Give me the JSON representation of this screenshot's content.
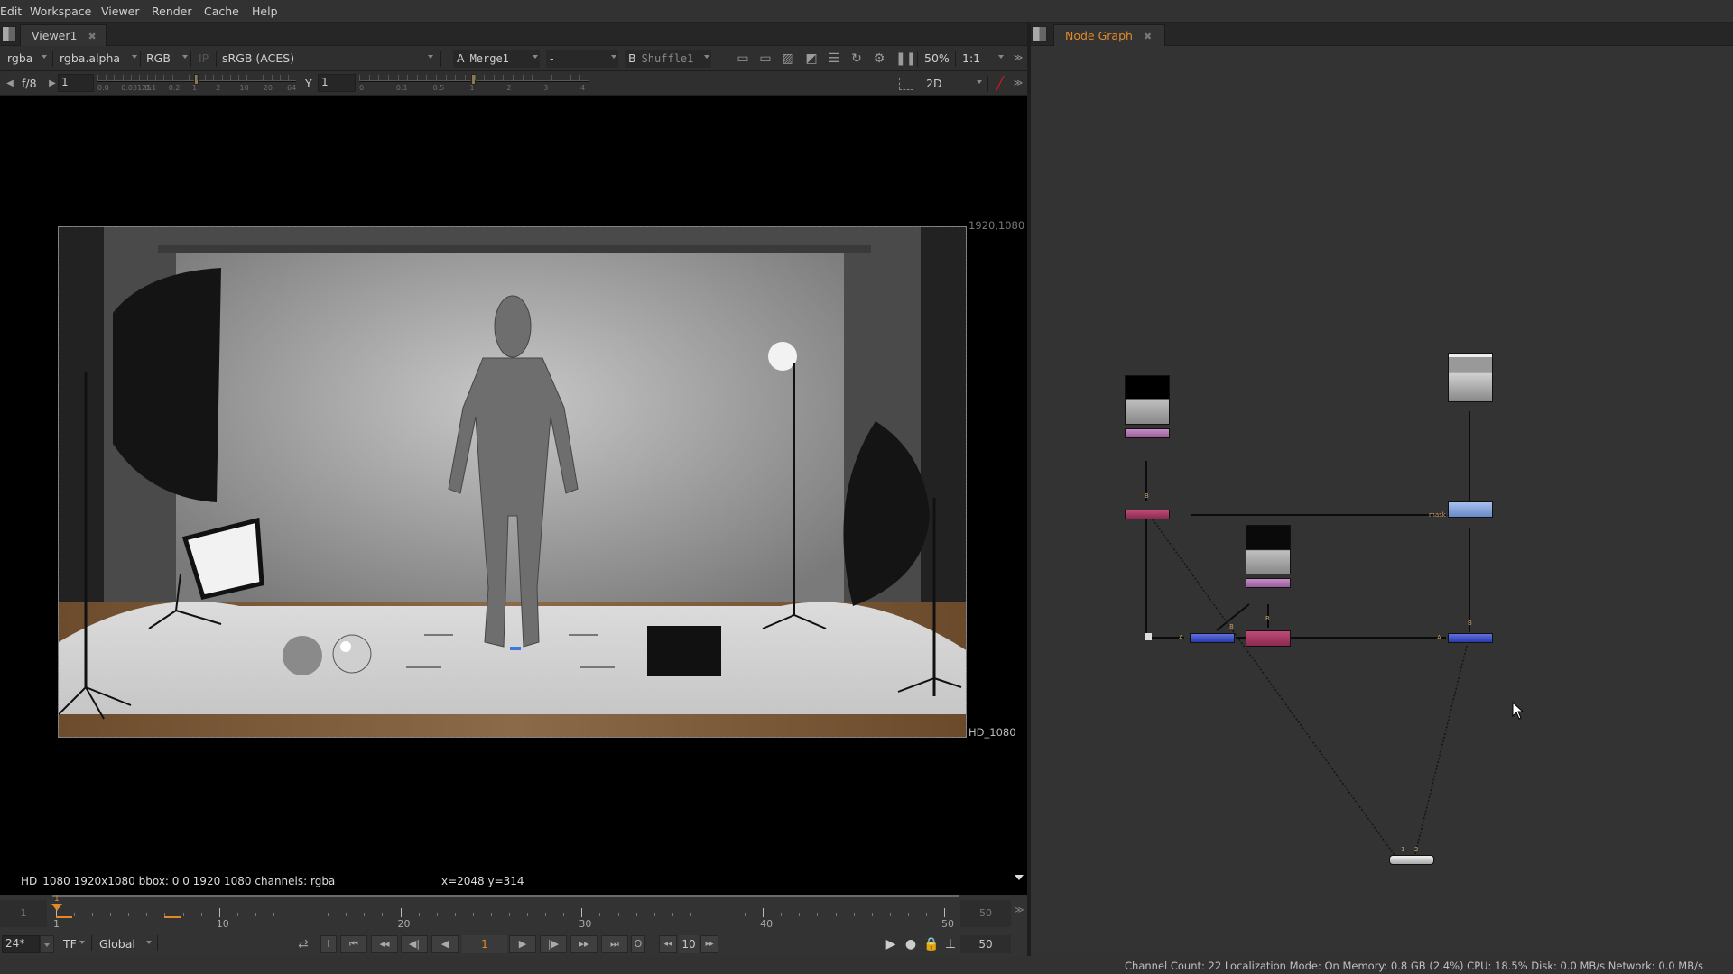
{
  "menubar": {
    "items": [
      "Edit",
      "Workspace",
      "Viewer",
      "Render",
      "Cache",
      "Help"
    ]
  },
  "viewer": {
    "tab_label": "Viewer1",
    "toolbar1": {
      "channels": "rgba",
      "alpha_channel": "rgba.alpha",
      "display_channels": "RGB",
      "ip_label": "IP",
      "colorspace": "sRGB (ACES)",
      "input_a_letter": "A",
      "input_a": "Merge1",
      "operation": "-",
      "input_b_letter": "B",
      "input_b": "Shuffle1",
      "zoom": "50%",
      "proxy": "1:1"
    },
    "toolbar2": {
      "fstop": "f/8",
      "gain_value": "1",
      "gain_ticks": [
        "0.0",
        "0.03125",
        "0.1",
        "0.2",
        "1",
        "2",
        "10",
        "20",
        "64"
      ],
      "gamma_label": "Y",
      "gamma_value": "1",
      "gamma_ticks": [
        "0",
        "0.1",
        "0.5",
        "1",
        "2",
        "3",
        "4"
      ],
      "view_mode": "2D"
    },
    "frame_top_right_label": "1920,1080",
    "frame_bottom_right_label": "HD_1080",
    "info_left": "HD_1080 1920x1080  bbox: 0 0 1920 1080 channels: rgba",
    "info_coords": "x=2048 y=314"
  },
  "timeline": {
    "start_frame": "1",
    "end_frame": "50",
    "current_marker": "1",
    "tick_labels": [
      "1",
      "10",
      "20",
      "30",
      "40",
      "50"
    ],
    "fps": "24*",
    "timecode_mode": "TF",
    "scope": "Global",
    "current_frame": "1",
    "increment": "10",
    "out_frame": "50"
  },
  "node_graph": {
    "tab_label": "Node Graph",
    "port_labels": {
      "mask": "mask",
      "a": "A",
      "b": "B",
      "one": "1",
      "two": "2"
    },
    "accent_color": "#e08a2a"
  },
  "statusbar": {
    "text": "Channel Count: 22  Localization Mode: On  Memory: 0.8 GB (2.4%) CPU: 18.5% Disk: 0.0 MB/s Network: 0.0 MB/s"
  }
}
